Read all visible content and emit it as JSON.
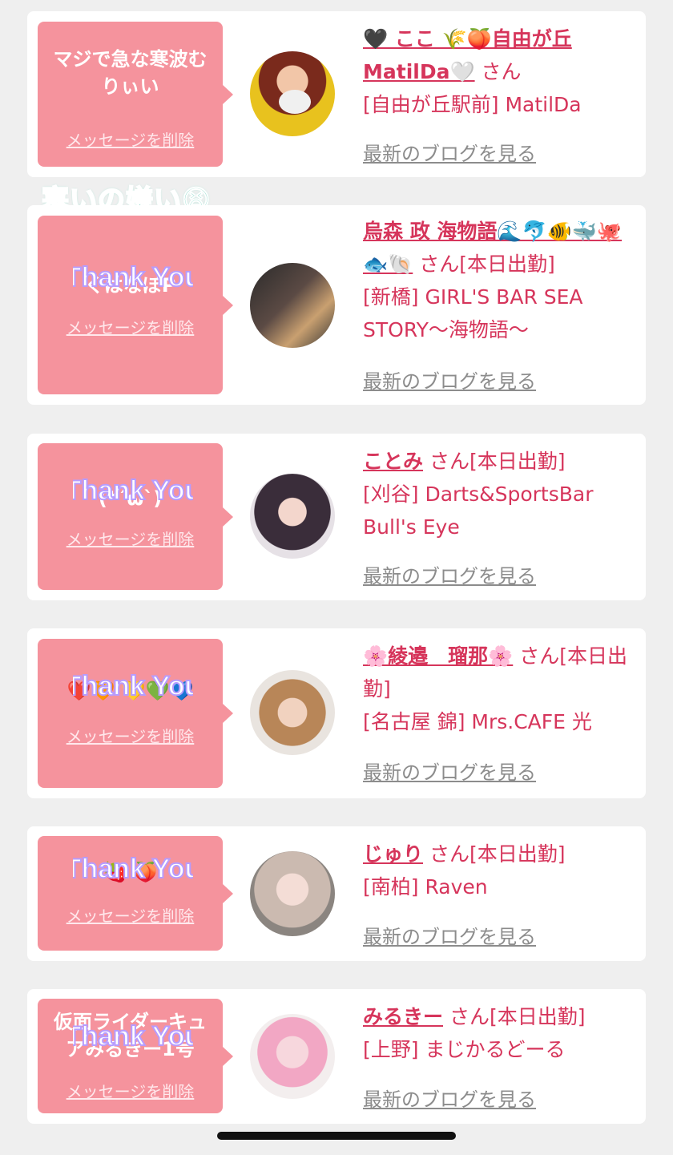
{
  "cards": [
    {
      "message": "マジで急な寒波むりぃい",
      "name": "🖤 ここ 🌾🍑自由が丘MatilDa🤍",
      "san": "さん",
      "shop": "[自由が丘駅前] MatilDa",
      "blog": "最新のブログを見る",
      "delete": "メッセージを削除"
    },
    {
      "message": "くはなぼP",
      "name": "烏森 政 海物語🌊🐬🐠🐳🐙🐟🐚",
      "san": "さん[本日出勤]",
      "shop": "[新橋] GIRL'S BAR SEA STORY〜海物語〜",
      "blog": "最新のブログを見る",
      "delete": "メッセージを削除"
    },
    {
      "message": "(*´ω`)",
      "name": "ことみ",
      "san": "さん[本日出勤]",
      "shop": "[刈谷] Darts&SportsBar Bull's Eye",
      "blog": "最新のブログを見る",
      "delete": "メッセージを削除"
    },
    {
      "message": "❤️🧡 💛💚💙",
      "name": "🌸綾邉　瑠那🌸",
      "san": "さん[本日出勤]",
      "shop": "[名古屋 錦] Mrs.CAFE 光",
      "blog": "最新のブログを見る",
      "delete": "メッセージを削除"
    },
    {
      "message": "🍓 🍑",
      "name": "じゅり",
      "san": "さん[本日出勤]",
      "shop": "[南柏] Raven",
      "blog": "最新のブログを見る",
      "delete": "メッセージを削除"
    },
    {
      "message": "仮面ライダーキュアみるきー1号",
      "name": "みるきー",
      "san": "さん[本日出勤]",
      "shop": "[上野] まじかるどーる",
      "blog": "最新のブログを見る",
      "delete": "メッセージを削除"
    }
  ],
  "overlay_text": "寒いの嫌い😫",
  "sticker_text": "Thank You"
}
